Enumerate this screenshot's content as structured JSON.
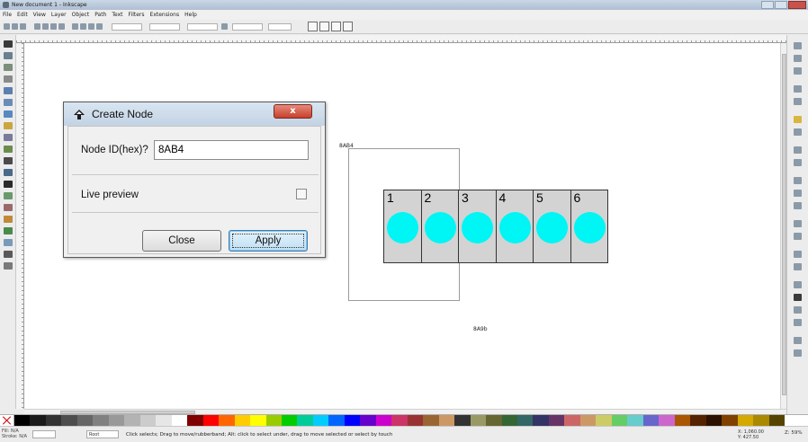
{
  "window": {
    "title": "New document 1 - Inkscape"
  },
  "menubar": {
    "items": [
      "File",
      "Edit",
      "View",
      "Layer",
      "Object",
      "Path",
      "Text",
      "Filters",
      "Extensions",
      "Help"
    ]
  },
  "canvas": {
    "label_top": "8AB4",
    "label_bottom": "8A9b",
    "cells": [
      {
        "number": "1"
      },
      {
        "number": "2"
      },
      {
        "number": "3"
      },
      {
        "number": "4"
      },
      {
        "number": "5"
      },
      {
        "number": "6"
      }
    ],
    "circle_color": "#00f5f5",
    "cell_fill": "#d3d3d3"
  },
  "dialog": {
    "title": "Create Node",
    "node_id_label": "Node ID(hex)?",
    "node_id_value": "8AB4",
    "live_preview_label": "Live preview",
    "live_preview_checked": false,
    "close_button": "Close",
    "apply_button": "Apply",
    "close_x": "x"
  },
  "statusbar": {
    "fill_label": "Fill:",
    "stroke_label": "Stroke:",
    "fill_value": "N/A",
    "stroke_value": "N/A",
    "layer": "Root",
    "message": "Click selects; Drag to move/rubberband; Alt: click to select under, drag to move selected or select by touch",
    "x_coord": "X: 1,060.00",
    "y_coord": "Y: 427.50",
    "zoom": "Z: 59%"
  },
  "colors": {
    "accent": "#3c7fb1",
    "close_red": "#c7402b"
  }
}
